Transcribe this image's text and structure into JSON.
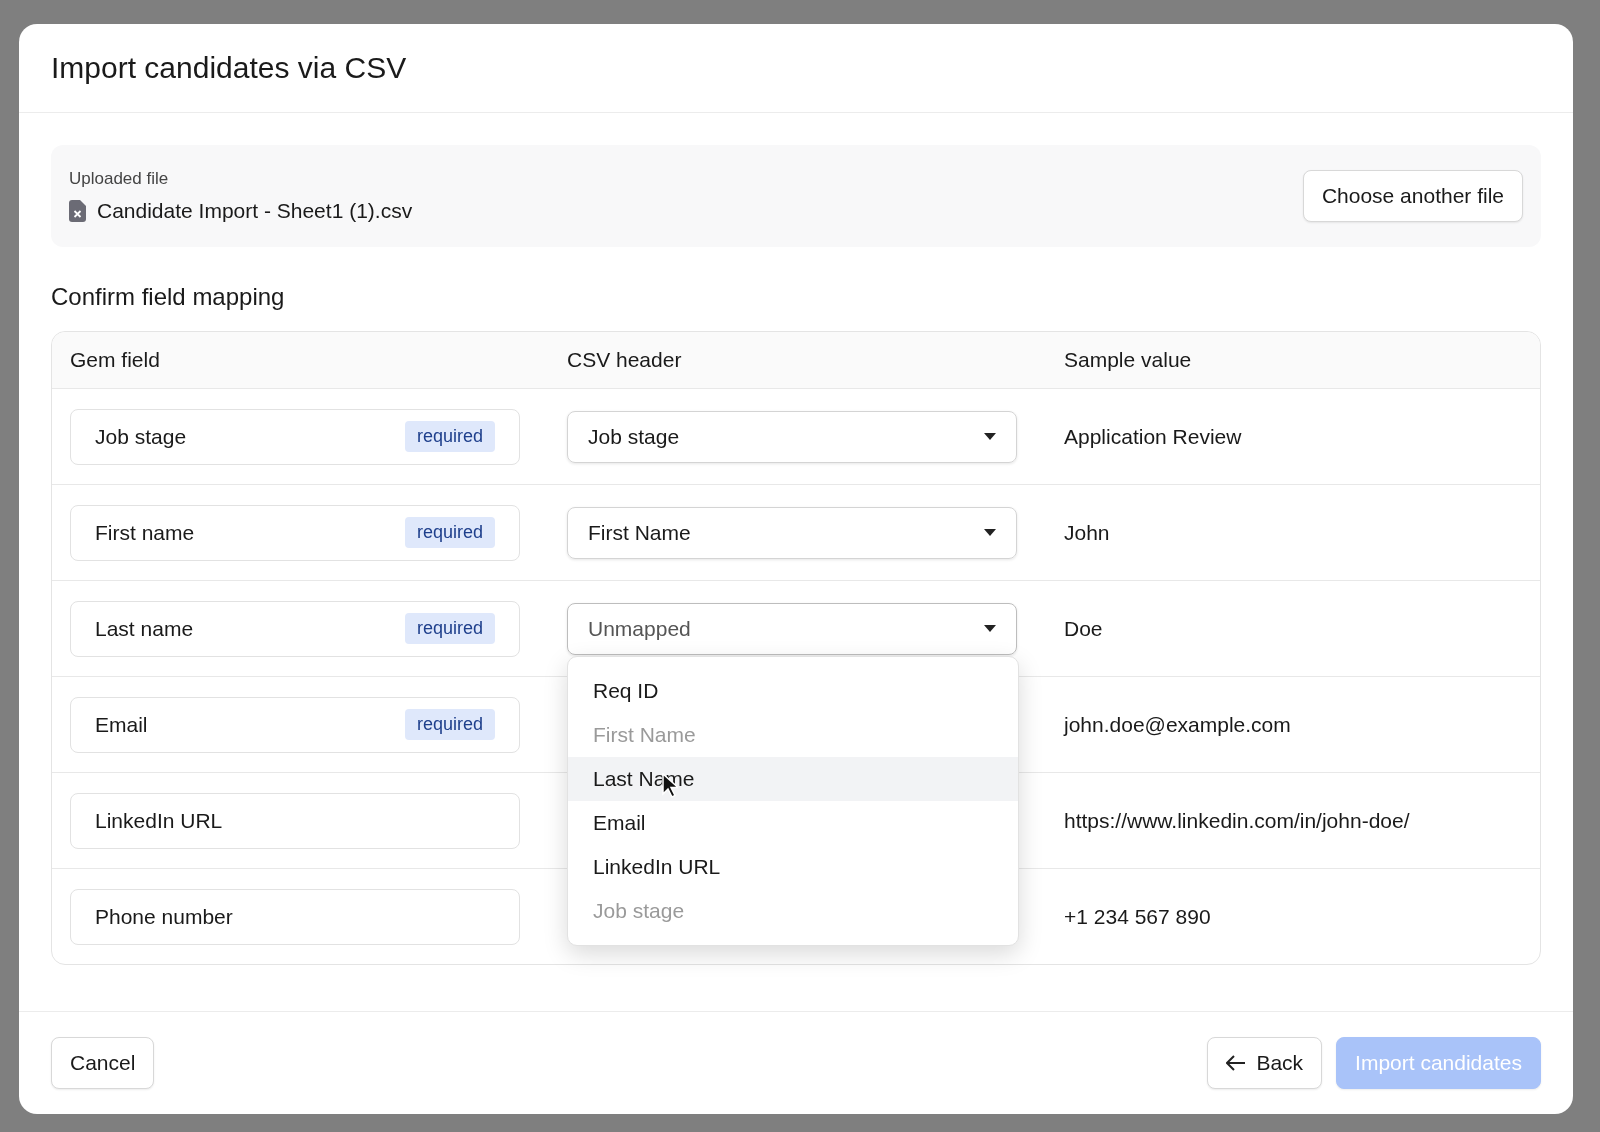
{
  "dialog": {
    "title": "Import candidates via CSV"
  },
  "upload": {
    "label": "Uploaded file",
    "file_name": "Candidate Import - Sheet1 (1).csv",
    "button": "Choose another file"
  },
  "mapping": {
    "heading": "Confirm field mapping",
    "columns": [
      "Gem field",
      "CSV header",
      "Sample value"
    ],
    "rows": [
      {
        "field": "Job stage",
        "badge": "required",
        "csv_header": {
          "value": "Job stage",
          "unmapped": false,
          "open": false
        },
        "sample": "Application Review"
      },
      {
        "field": "First name",
        "badge": "required",
        "csv_header": {
          "value": "First Name",
          "unmapped": false,
          "open": false
        },
        "sample": "John"
      },
      {
        "field": "Last name",
        "badge": "required",
        "csv_header": {
          "value": "Unmapped",
          "unmapped": true,
          "open": true
        },
        "sample": "Doe"
      },
      {
        "field": "Email",
        "badge": "required",
        "sample": "john.doe@example.com"
      },
      {
        "field": "LinkedIn URL",
        "sample": "https://www.linkedin.com/in/john-doe/"
      },
      {
        "field": "Phone number",
        "sample": "+1 234 567 890"
      }
    ],
    "menu": [
      {
        "label": "Req ID",
        "disabled": false,
        "highlighted": false
      },
      {
        "label": "First Name",
        "disabled": true,
        "highlighted": false
      },
      {
        "label": "Last Name",
        "disabled": false,
        "highlighted": true
      },
      {
        "label": "Email",
        "disabled": false,
        "highlighted": false
      },
      {
        "label": "LinkedIn URL",
        "disabled": false,
        "highlighted": false
      },
      {
        "label": "Job stage",
        "disabled": true,
        "highlighted": false
      }
    ]
  },
  "footer": {
    "cancel": "Cancel",
    "back": "Back",
    "import": {
      "label": "Import candidates",
      "disabled": true
    }
  }
}
